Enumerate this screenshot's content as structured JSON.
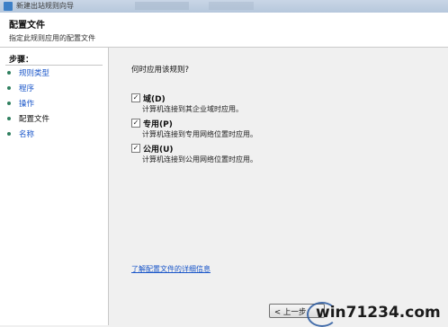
{
  "window": {
    "title": "新建出站规则向导"
  },
  "header": {
    "title": "配置文件",
    "subtitle": "指定此规则应用的配置文件"
  },
  "sidebar": {
    "steps_label": "步骤：",
    "items": [
      {
        "label": "规则类型",
        "state": "link"
      },
      {
        "label": "程序",
        "state": "link"
      },
      {
        "label": "操作",
        "state": "link"
      },
      {
        "label": "配置文件",
        "state": "current"
      },
      {
        "label": "名称",
        "state": "link"
      }
    ]
  },
  "main": {
    "question": "何时应用该规则?",
    "options": [
      {
        "label": "域(D)",
        "checked": true,
        "description": "计算机连接到其企业域时应用。"
      },
      {
        "label": "专用(P)",
        "checked": true,
        "description": "计算机连接到专用网络位置时应用。"
      },
      {
        "label": "公用(U)",
        "checked": true,
        "description": "计算机连接到公用网络位置时应用。"
      }
    ],
    "learn_more": "了解配置文件的详细信息"
  },
  "footer": {
    "back_label": "< 上一步"
  },
  "watermark": {
    "text": "win71234.com"
  },
  "colors": {
    "link": "#1a56c9",
    "sidebar_bullet": "#2f7f5f"
  }
}
